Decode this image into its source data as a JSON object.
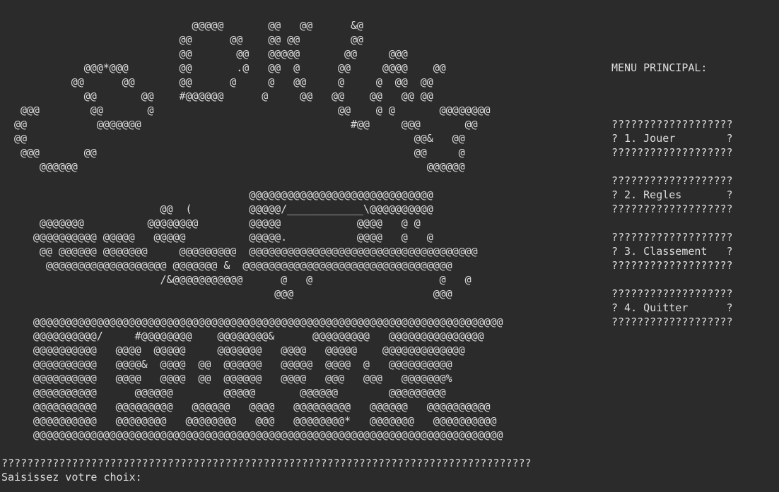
{
  "ascii_logo": [
    "                              @@@@@       @@   @@      &@",
    "                            @@      @@    @@ @@        @@",
    "                            @@       @@   @@@@@       @@     @@@",
    "             @@@*@@@        @@       .@   @@  @      @@     @@@@    @@",
    "           @@      @@       @@      @     @   @@     @     @  @@  @@",
    "             @@       @@    #@@@@@@      @     @@   @@    @@   @@ @@",
    "   @@@        @@       @                             @@    @ @       @@@@@@@@",
    "  @@           @@@@@@@                                 #@@     @@@       @@",
    "  @@                                                             @@&   @@",
    "   @@@       @@                                                  @@     @",
    "      @@@@@@                                                       @@@@@@"
  ],
  "ascii_car": [
    "                                       @@@@@@@@@@@@@@@@@@@@@@@@@@@@@",
    "                         @@  (         @@@@@/____________\\@@@@@@@@@@",
    "      @@@@@@@          @@@@@@@@        @@@@@            @@@@   @ @",
    "     @@@@@@@@@@ @@@@@   @@@@@          @@@@@.           @@@@   @   @",
    "      @@ @@@@@@ @@@@@@@     @@@@@@@@@  @@@@@@@@@@@@@@@@@@@@@@@@@@@@@@@@@@@@",
    "       @@@@@@@@@@@@@@@@@@@ @@@@@@@ &  @@@@@@@@@@@@@@@@@@@@@@@@@@@@@@@@@",
    "                         /&@@@@@@@@@@@      @   @                    @   @",
    "                                           @@@                      @@@"
  ],
  "ascii_title": [
    "     @@@@@@@@@@@@@@@@@@@@@@@@@@@@@@@@@@@@@@@@@@@@@@@@@@@@@@@@@@@@@@@@@@@@@@@@@@",
    "     @@@@@@@@@@/     #@@@@@@@@    @@@@@@@@&      @@@@@@@@@   @@@@@@@@@@@@@@@",
    "     @@@@@@@@@@   @@@@  @@@@@     @@@@@@@   @@@@   @@@@@    @@@@@@@@@@@@@",
    "     @@@@@@@@@@   @@@@&  @@@@  @@  @@@@@@   @@@@@  @@@@  @   @@@@@@@@@@",
    "     @@@@@@@@@@   @@@@   @@@@  @@  @@@@@@   @@@@   @@@   @@@   @@@@@@@%",
    "     @@@@@@@@@@      @@@@@@        @@@@@       @@@@@@        @@@@@@@@@",
    "     @@@@@@@@@@   @@@@@@@@@   @@@@@@   @@@@   @@@@@@@@@   @@@@@@   @@@@@@@@@@",
    "     @@@@@@@@@@   @@@@@@@@   @@@@@@@@   @@@   @@@@@@@@*   @@@@@@@   @@@@@@@@@@",
    "     @@@@@@@@@@@@@@@@@@@@@@@@@@@@@@@@@@@@@@@@@@@@@@@@@@@@@@@@@@@@@@@@@@@@@@@@@@"
  ],
  "menu": {
    "heading": "MENU PRINCIPAL:",
    "items": [
      {
        "border_top": "???????????????????",
        "label": "? 1. Jouer        ?",
        "border_bottom": "???????????????????"
      },
      {
        "border_top": "???????????????????",
        "label": "? 2. Regles       ?",
        "border_bottom": "???????????????????"
      },
      {
        "border_top": "???????????????????",
        "label": "? 3. Classement   ?",
        "border_bottom": "???????????????????"
      },
      {
        "border_top": "???????????????????",
        "label": "? 4. Quitter      ?",
        "border_bottom": "???????????????????"
      }
    ]
  },
  "separator": "???????????????????????????????????????????????????????????????????????????????????",
  "prompt": "Saisissez votre choix:",
  "colors": {
    "background": "#2b2b2b",
    "text": "#dcdcdc"
  }
}
